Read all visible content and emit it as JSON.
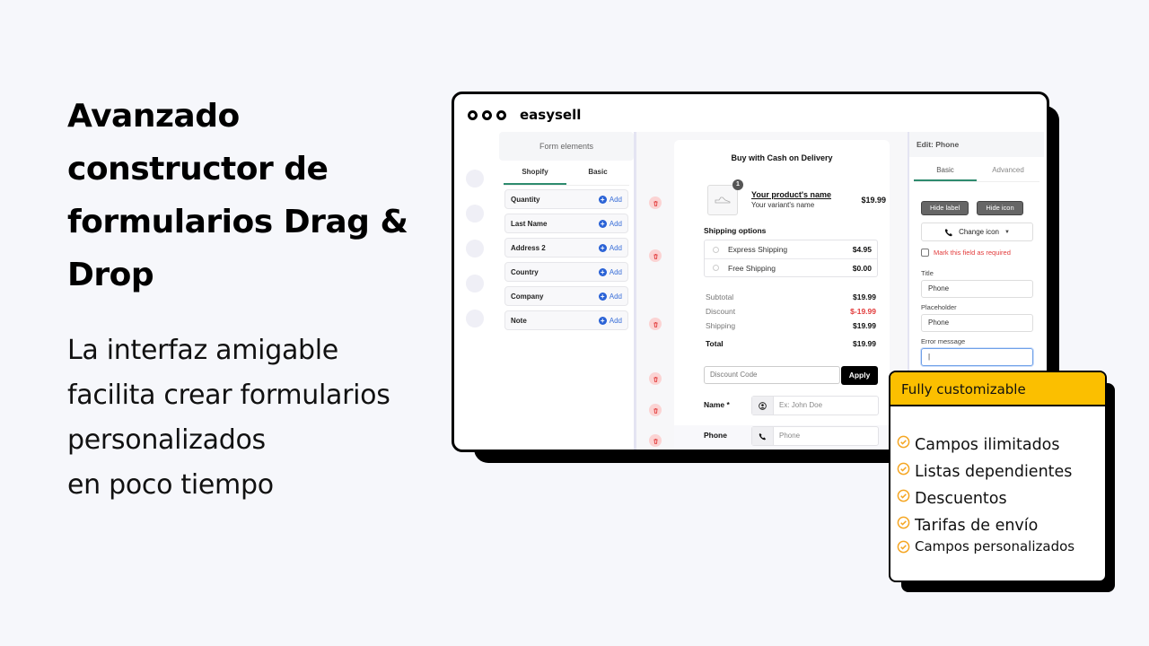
{
  "hero": {
    "headline_lines": [
      "Avanzado",
      "constructor de",
      "formularios Drag &",
      "Drop"
    ],
    "subline_lines": [
      "La interfaz amigable",
      "facilita crear formularios",
      "personalizados",
      "en poco tiempo"
    ]
  },
  "app": {
    "brand": "easysell",
    "elements_panel": {
      "title": "Form elements",
      "tabs": [
        "Shopify",
        "Basic"
      ],
      "active_tab": "Shopify",
      "add_label": "Add",
      "items": [
        "Quantity",
        "Last Name",
        "Address 2",
        "Country",
        "Company",
        "Note"
      ]
    },
    "form": {
      "title": "Buy with Cash on Delivery",
      "product": {
        "qty_badge": "1",
        "name": "Your product's name",
        "variant": "Your variant's name",
        "price": "$19.99"
      },
      "shipping": {
        "title": "Shipping options",
        "options": [
          {
            "name": "Express Shipping",
            "price": "$4.95"
          },
          {
            "name": "Free Shipping",
            "price": "$0.00"
          }
        ]
      },
      "summary": {
        "subtotal_label": "Subtotal",
        "subtotal": "$19.99",
        "discount_label": "Discount",
        "discount": "$-19.99",
        "shipping_label": "Shipping",
        "shipping": "$19.99",
        "total_label": "Total",
        "total": "$19.99"
      },
      "discount_placeholder": "Discount Code",
      "apply_label": "Apply",
      "fields": [
        {
          "label": "Name *",
          "placeholder": "Ex: John Doe",
          "icon": "user-icon"
        },
        {
          "label": "Phone",
          "placeholder": "Phone",
          "icon": "phone-icon"
        }
      ]
    },
    "edit_panel": {
      "title": "Edit: Phone",
      "tabs": [
        "Basic",
        "Advanced"
      ],
      "active_tab": "Basic",
      "hide_label": "Hide label",
      "hide_icon": "Hide icon",
      "change_icon": "Change icon",
      "required_label": "Mark this field as required",
      "title_label": "Title",
      "title_value": "Phone",
      "placeholder_label": "Placeholder",
      "placeholder_value": "Phone",
      "error_label": "Error message",
      "error_value": ""
    }
  },
  "features": {
    "title": "Fully customizable",
    "items": [
      "Campos ilimitados",
      "Listas dependientes",
      "Descuentos",
      "Tarifas de envío",
      "Campos personalizados"
    ],
    "accent": "#fbbf00",
    "check_color": "#f5a623"
  }
}
